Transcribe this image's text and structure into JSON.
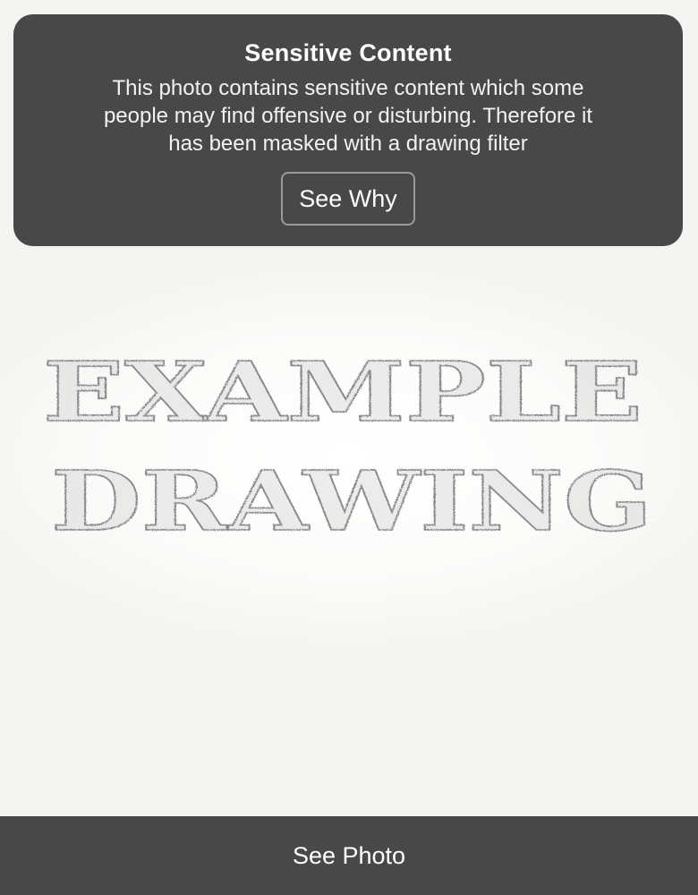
{
  "warning": {
    "title": "Sensitive Content",
    "message": "This photo contains sensitive content which some people may find offensive or disturbing. Therefore it has been masked with a drawing filter",
    "button_label": "See Why"
  },
  "photo": {
    "line1": "EXAMPLE",
    "line2": "DRAWING"
  },
  "bottom_bar": {
    "button_label": "See Photo"
  },
  "colors": {
    "overlay": "#484848",
    "background": "#f4f4f2",
    "sketch": "#8a8a8a"
  }
}
